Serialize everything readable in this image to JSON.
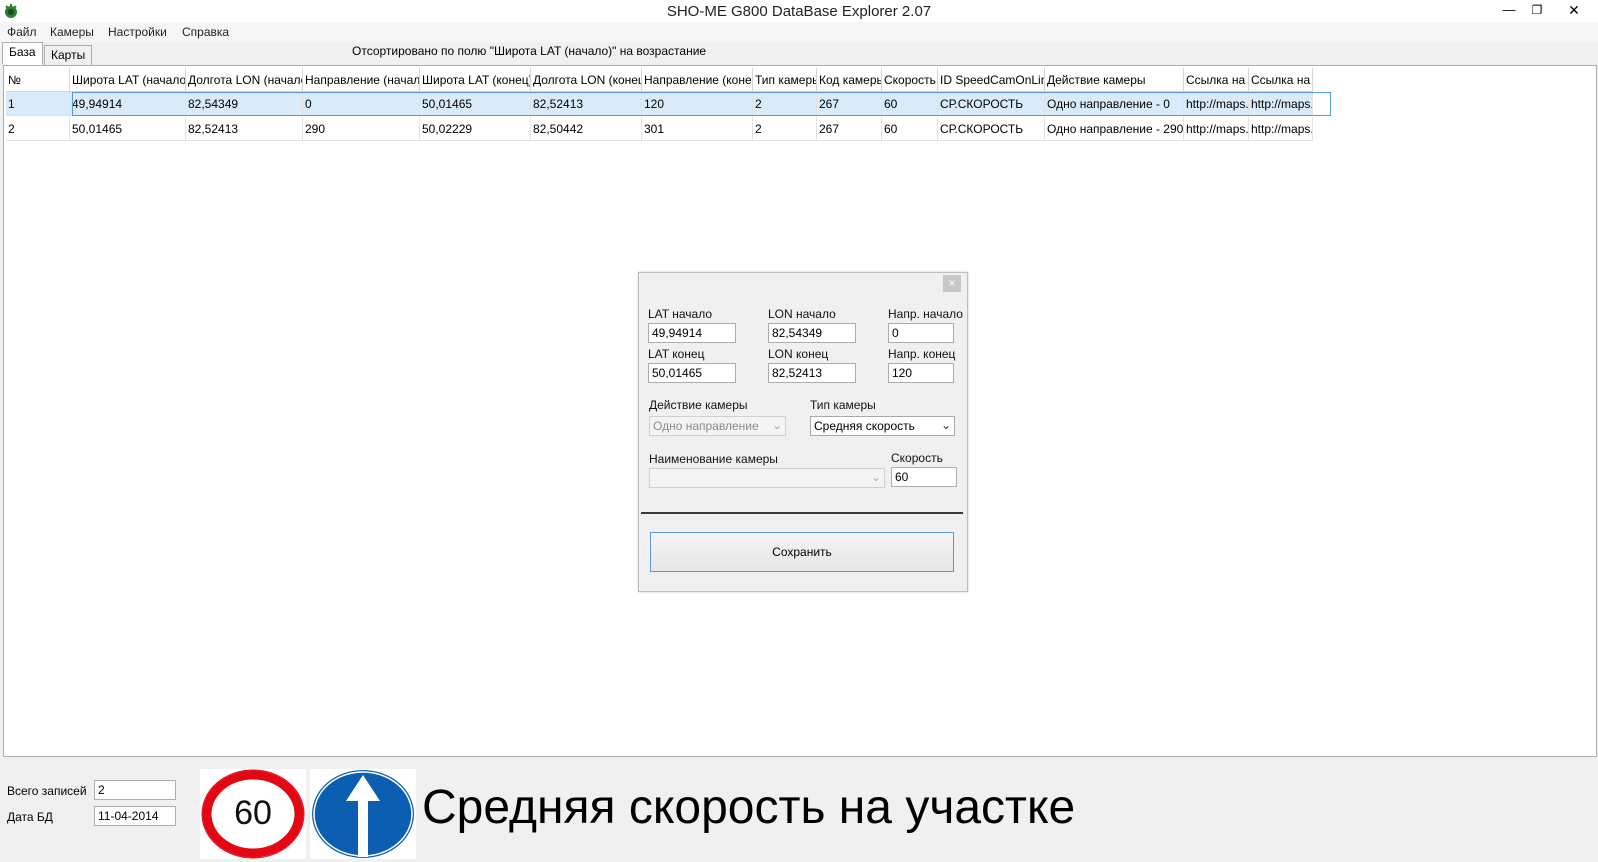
{
  "window": {
    "title": "SHO-ME G800 DataBase Explorer 2.07",
    "min_glyph": "—",
    "max_glyph": "❐",
    "close_glyph": "✕"
  },
  "menu": [
    "Файл",
    "Камеры",
    "Настройки",
    "Справка"
  ],
  "tabs": {
    "base": "База",
    "maps": "Карты"
  },
  "sort_status": "Отсортировано по полю \"Широта LAT (начало)\" на возрастание",
  "table": {
    "columns": [
      "№",
      "Широта LAT (начало)",
      "Долгота LON (начало)",
      "Направление (начало)",
      "Широта LAT (конец)",
      "Долгота LON (конец)",
      "Направление (конец)",
      "Тип камеры",
      "Код камеры",
      "Скорость",
      "ID SpeedCamOnLine",
      "Действие камеры",
      "Ссылка на G",
      "Ссылка на Я"
    ],
    "rows": [
      [
        "1",
        "49,94914",
        "82,54349",
        "0",
        "50,01465",
        "82,52413",
        "120",
        "2",
        "267",
        "60",
        "СР.СКОРОСТЬ",
        "Одно направление - 0",
        "http://maps.",
        "http://maps."
      ],
      [
        "2",
        "50,01465",
        "82,52413",
        "290",
        "50,02229",
        "82,50442",
        "301",
        "2",
        "267",
        "60",
        "СР.СКОРОСТЬ",
        "Одно направление - 290",
        "http://maps.",
        "http://maps."
      ]
    ],
    "selected_row": 0
  },
  "dialog": {
    "close_glyph": "×",
    "lat_start_label": "LAT начало",
    "lat_start_value": "49,94914",
    "lon_start_label": "LON начало",
    "lon_start_value": "82,54349",
    "dir_start_label": "Напр. начало",
    "dir_start_value": "0",
    "lat_end_label": "LAT конец",
    "lat_end_value": "50,01465",
    "lon_end_label": "LON конец",
    "lon_end_value": "82,52413",
    "dir_end_label": "Напр. конец",
    "dir_end_value": "120",
    "action_label": "Действие камеры",
    "action_value": "Одно направление",
    "type_label": "Тип камеры",
    "type_value": "Средняя скорость",
    "name_label": "Наименование камеры",
    "name_value": "",
    "speed_label": "Скорость",
    "speed_value": "60",
    "save_label": "Сохранить"
  },
  "bottom": {
    "records_label": "Всего записей",
    "records_value": "2",
    "date_label": "Дата БД",
    "date_value": "11-04-2014",
    "speed_sign_value": "60",
    "caption": "Средняя скорость на участке"
  },
  "colors": {
    "selection": "#d9ebf9",
    "selection_border": "#5b9bd5",
    "sign_red": "#e30613",
    "sign_blue": "#0c5fb0"
  }
}
